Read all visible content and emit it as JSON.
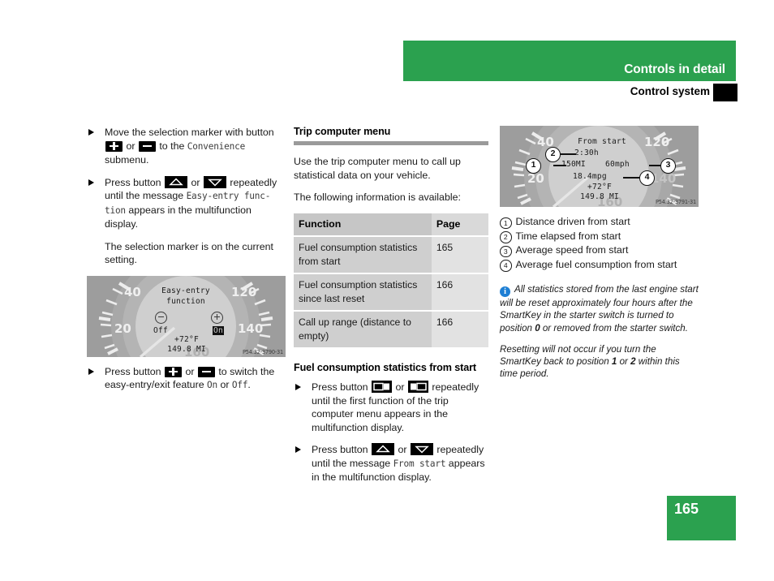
{
  "header": {
    "chapter_title": "Controls in detail",
    "section_title": "Control system"
  },
  "footer": {
    "page_number": "165"
  },
  "colors": {
    "brand_green": "#2ba14f",
    "info_blue": "#1e7fd4",
    "table_header_gray": "#c6c6c6",
    "table_cell_gray": "#cfcfcf",
    "table_page_gray": "#e2e2e2",
    "rule_gray": "#9a9a9a"
  },
  "left_column": {
    "bullets": [
      {
        "text_1": "Move the selection marker with button ",
        "btn_1": "plus-button",
        "text_2": " or ",
        "btn_2": "minus-button",
        "text_3": " to the ",
        "mono_1": "Convenience",
        "text_4": " submenu."
      },
      {
        "text_1": "Press button ",
        "btn_1": "up-arrow-button",
        "text_2": " or ",
        "btn_2": "down-arrow-button",
        "text_3": " repeatedly until the message ",
        "mono_1": "Easy-entry func-",
        "mono_2": "tion",
        "text_4": " appears in the multifunction display."
      }
    ],
    "note": "The selection marker is on the current setting.",
    "cluster_image": {
      "title_line_1": "Easy-entry",
      "title_line_2": "function",
      "option_off": "Off",
      "option_on": "On",
      "temperature": "+72°F",
      "odometer": "149.8 MI",
      "tick_20": "20",
      "tick_40": "40",
      "tick_120": "120",
      "tick_140": "140",
      "tick_160": "160",
      "figure_code": "P54.32-3790-31"
    },
    "final_bullet": {
      "text_1": "Press button ",
      "btn_1": "plus-button",
      "text_2": " or ",
      "btn_2": "minus-button",
      "text_3": " to switch the easy-entry/exit feature ",
      "mono_1": "On",
      "text_4": " or ",
      "mono_2": "Off",
      "text_5": "."
    }
  },
  "middle_column": {
    "heading": "Trip computer menu",
    "intro_paragraph": "Use the trip computer menu to call up statistical data on your vehicle.",
    "availability_paragraph": "The following information is available:",
    "table": {
      "columns": [
        "Function",
        "Page"
      ],
      "rows": [
        {
          "function": "Fuel consumption statistics from start",
          "page": "165"
        },
        {
          "function": "Fuel consumption statistics since last reset",
          "page": "166"
        },
        {
          "function": "Call up range (distance to empty)",
          "page": "166"
        }
      ]
    },
    "subheading": "Fuel consumption statistics from start",
    "bullets": [
      {
        "text_1": "Press button ",
        "btn_1": "trip-left-button",
        "text_2": " or ",
        "btn_2": "trip-right-button",
        "text_3": " repeatedly until the first function of the trip computer menu appears in the multifunction display."
      },
      {
        "text_1": "Press button ",
        "btn_1": "up-arrow-button",
        "text_2": " or ",
        "btn_2": "down-arrow-button",
        "text_3": " repeatedly until the message ",
        "mono_1": "From start",
        "text_4": " appears in the multifunction display."
      }
    ]
  },
  "right_column": {
    "cluster_image": {
      "title": "From start",
      "time_value": "2:30h",
      "distance_value": "150MI",
      "speed_value": "60mph",
      "consumption_value": "18.4mpg",
      "temperature": "+72°F",
      "odometer": "149.8 MI",
      "tick_20": "20",
      "tick_40": "40",
      "tick_120": "120",
      "tick_140": "140",
      "tick_160": "160",
      "figure_code": "P54.32-3791-31",
      "callouts": [
        "1",
        "2",
        "3",
        "4"
      ]
    },
    "legend": [
      {
        "num": "1",
        "label": "Distance driven from start"
      },
      {
        "num": "2",
        "label": "Time elapsed from start"
      },
      {
        "num": "3",
        "label": "Average speed from start"
      },
      {
        "num": "4",
        "label": "Average fuel consumption from start"
      }
    ],
    "note_1": {
      "icon": "info-icon",
      "part_1": "All statistics stored from the last engine start will be reset approximately four hours after the SmartKey in the starter switch is turned to position ",
      "bold_1": "0",
      "part_2": " or removed from the starter switch."
    },
    "note_2": {
      "part_1": "Resetting will not occur if you turn the SmartKey back to position ",
      "bold_1": "1",
      "part_2": " or ",
      "bold_2": "2",
      "part_3": " within this time period."
    }
  }
}
